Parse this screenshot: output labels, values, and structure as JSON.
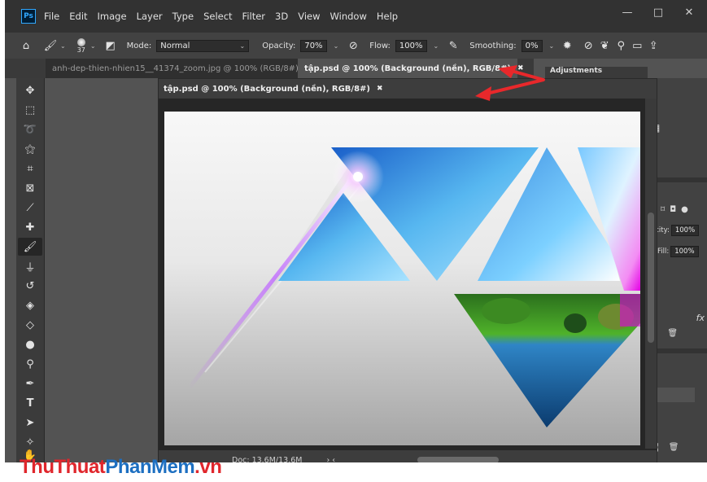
{
  "app": {
    "logo": "Ps",
    "menu": [
      "File",
      "Edit",
      "Image",
      "Layer",
      "Type",
      "Select",
      "Filter",
      "3D",
      "View",
      "Window",
      "Help"
    ],
    "window_buttons": {
      "minimize": "—",
      "maximize": "□",
      "close": "✕"
    }
  },
  "options_bar": {
    "brush_size": "37",
    "mode_label": "Mode:",
    "mode_value": "Normal",
    "opacity_label": "Opacity:",
    "opacity_value": "70%",
    "flow_label": "Flow:",
    "flow_value": "100%",
    "smoothing_label": "Smoothing:",
    "smoothing_value": "0%"
  },
  "tabs": [
    {
      "label": "anh-dep-thien-nhien15__41374_zoom.jpg @ 100% (RGB/8#)",
      "close": "✖"
    },
    {
      "label": "tập.psd @ 100% (Background (nền), RGB/8#)",
      "close": "✖"
    }
  ],
  "floating_doc": {
    "title": "tập.psd @ 100% (Background (nền), RGB/8#)",
    "close": "✖",
    "status_text": "Doc: 13.6M/13.6M",
    "status_nav": "›  ‹"
  },
  "panels": {
    "adjustments_label": "Adjustments",
    "opacity_label": "acity:",
    "opacity_value": "100%",
    "fill_label": "Fill:",
    "fill_value": "100%",
    "fx_label": "fx"
  },
  "watermark": {
    "part1": "ThuThuat",
    "part2": "PhanMem",
    "part3": ".vn"
  },
  "colors": {
    "annotation_arrow": "#e8282b",
    "brand_red": "#e0262c",
    "brand_blue": "#1d6fc1",
    "ps_blue": "#31a8ff"
  },
  "icons": [
    "home-icon",
    "brush-icon",
    "airbrush-icon",
    "pressure-icon",
    "settings-icon",
    "butterfly-icon",
    "search-icon",
    "workspace-icon",
    "share-icon"
  ]
}
